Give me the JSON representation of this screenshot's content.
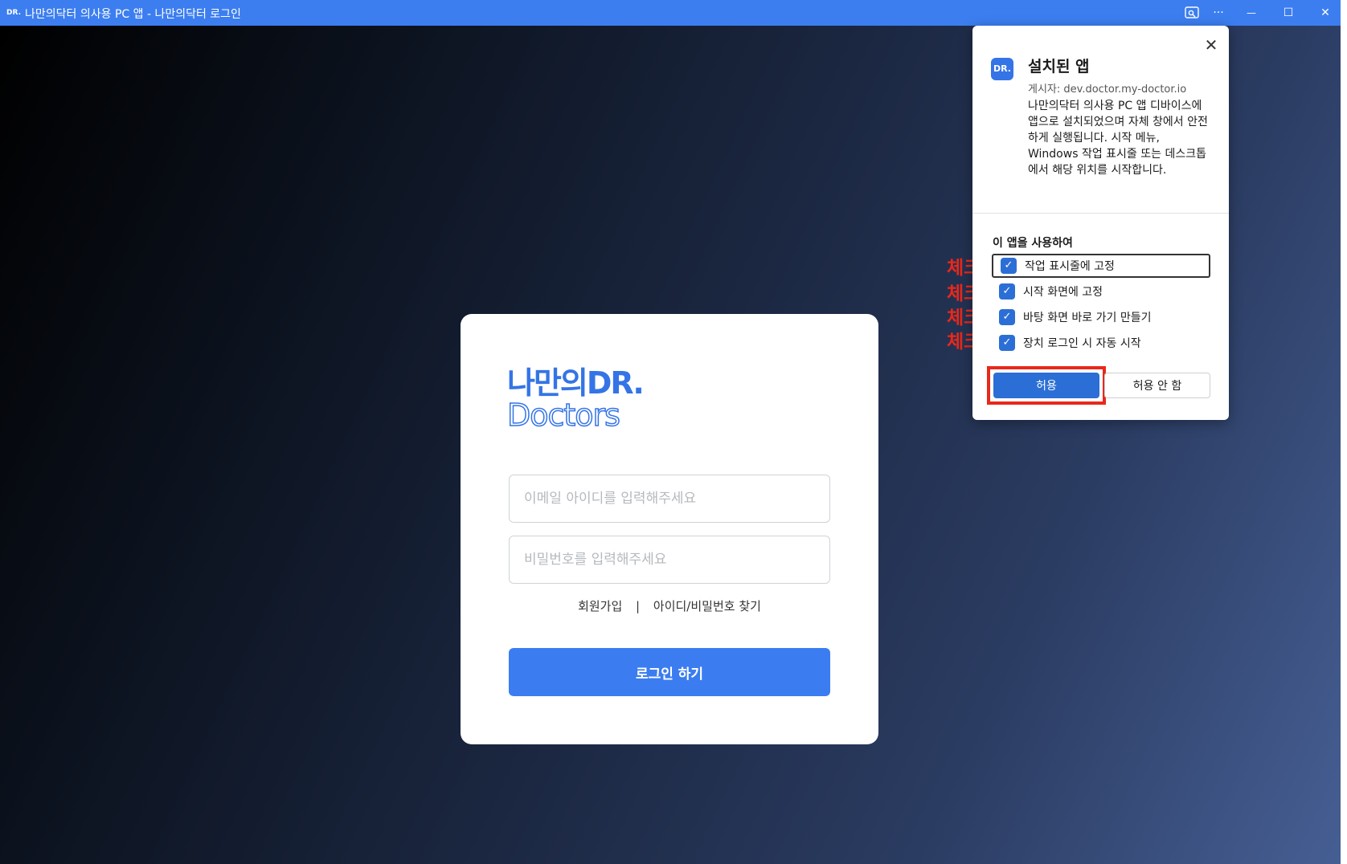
{
  "window": {
    "app_icon_text": "DR.",
    "title": "나만의닥터 의사용 PC 앱 - 나만의닥터 로그인",
    "cast_icon": "cast-icon",
    "more_glyph": "···",
    "minimize_glyph": "—",
    "maximize_glyph": "☐",
    "close_glyph": "✕"
  },
  "login": {
    "logo_top": "나만의DR.",
    "logo_bottom": "Doctors",
    "email_placeholder": "이메일 아이디를 입력해주세요",
    "password_placeholder": "비밀번호를 입력해주세요",
    "signup_link": "회원가입",
    "separator": "|",
    "find_link": "아이디/비밀번호 찾기",
    "login_button": "로그인 하기"
  },
  "popup": {
    "close_glyph": "✕",
    "app_icon_text": "DR.",
    "title": "설치된 앱",
    "publisher": "게시자: dev.doctor.my-doctor.io",
    "description": "나만의닥터 의사용 PC 앱 디바이스에 앱으로 설치되었으며 자체 창에서 안전하게 실행됩니다. 시작 메뉴, Windows 작업 표시줄 또는 데스크톱에서 해당 위치를 시작합니다.",
    "section_label": "이 앱을 사용하여",
    "options": [
      {
        "label": "작업 표시줄에 고정",
        "checked": true
      },
      {
        "label": "시작 화면에 고정",
        "checked": true
      },
      {
        "label": "바탕 화면 바로 가기 만들기",
        "checked": true
      },
      {
        "label": "장치 로그인 시 자동 시작",
        "checked": true
      }
    ],
    "check_glyph": "✓",
    "allow_button": "허용",
    "deny_button": "허용 안 함"
  },
  "annotations": {
    "check_note": "체크!"
  },
  "colors": {
    "titlebar": "#3c7ef0",
    "accent": "#3b7df0",
    "highlight_red": "#e8281a"
  }
}
